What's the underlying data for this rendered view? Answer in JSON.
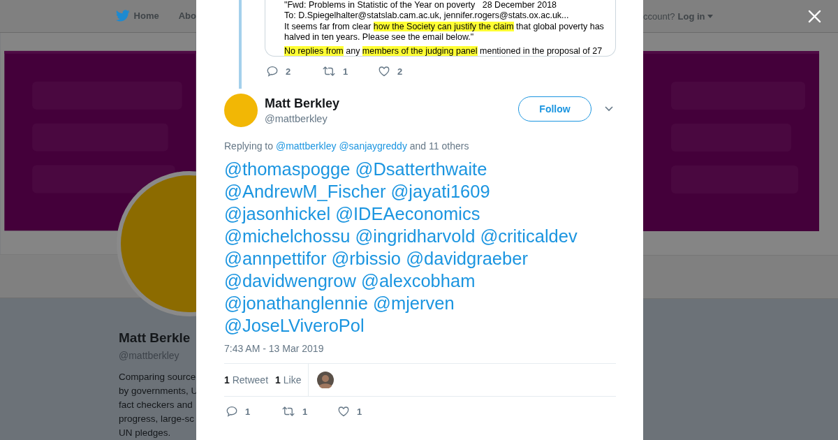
{
  "background": {
    "nav": {
      "items": [
        {
          "kind": "home",
          "label": "Home"
        },
        {
          "kind": "plain",
          "label": "Abo"
        }
      ],
      "account_prompt": "ccount?",
      "login": "Log in"
    },
    "profile": {
      "name": "Matt Berkle",
      "handle": "@mattberkley",
      "bio_lines": [
        "Comparing source",
        "by governments, U",
        "fact checkers and",
        "progress, large-sc",
        "UN pledges."
      ]
    }
  },
  "thread_parent": {
    "quoted_paragraphs": [
      {
        "lines": [
          [
            {
              "text": "\"Fwd: Problems in Statistic of the Year on poverty   28 December 2018",
              "highlighted": false
            }
          ],
          [
            {
              "text": "To: D.Spiegelhalter@statslab.cam.ac.uk, jennifer.rogers@stats.ox.ac.uk...",
              "highlighted": false
            }
          ],
          [
            {
              "text": "It seems far from clear ",
              "highlighted": false
            },
            {
              "text": "how the Society can justify the claim",
              "highlighted": true
            },
            {
              "text": " that global poverty has",
              "highlighted": false
            }
          ],
          [
            {
              "text": "halved in ten years. Please see the email below.\"",
              "highlighted": false
            }
          ]
        ]
      },
      {
        "lines": [
          [
            {
              "text": "No replies from",
              "highlighted": true
            },
            {
              "text": " any ",
              "highlighted": false
            },
            {
              "text": "members of the judging panel",
              "highlighted": true
            },
            {
              "text": " mentioned in the proposal of 27",
              "highlighted": false
            }
          ]
        ]
      }
    ],
    "actions": [
      {
        "kind": "reply",
        "count": "2"
      },
      {
        "kind": "retweet",
        "count": "1"
      },
      {
        "kind": "like",
        "count": "2"
      }
    ]
  },
  "tweet": {
    "author": "Matt Berkley",
    "handle": "@mattberkley",
    "follow_label": "Follow",
    "replying_to": {
      "prefix": "Replying to",
      "mentions": [
        "@mattberkley",
        "@sanjaygreddy"
      ],
      "suffix": "and 11 others"
    },
    "text_lines": [
      [
        "@thomaspogge",
        "@Dsatterthwaite"
      ],
      [
        "@AndrewM_Fischer",
        "@jayati1609"
      ],
      [
        "@jasonhickel",
        "@IDEAeconomics"
      ],
      [
        "@michelchossu",
        "@ingridharvold",
        "@criticaldev"
      ],
      [
        "@annpettifor",
        "@rbissio",
        "@davidgraeber"
      ],
      [
        "@davidwengrow",
        "@alexcobham"
      ],
      [
        "@jonathanglennie",
        "@mjerven"
      ],
      [
        "@JoseLViveroPol"
      ]
    ],
    "timestamp": "7:43 AM - 13 Mar 2019",
    "stats": [
      {
        "count": "1",
        "label": "Retweet"
      },
      {
        "count": "1",
        "label": "Like"
      }
    ],
    "actions": [
      {
        "kind": "reply",
        "count": "1"
      },
      {
        "kind": "retweet",
        "count": "1"
      },
      {
        "kind": "like",
        "count": "1"
      }
    ]
  }
}
